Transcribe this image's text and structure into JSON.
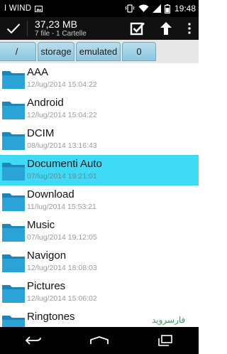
{
  "statusbar": {
    "carrier": "I WIND",
    "time": "19:48"
  },
  "actionbar": {
    "title": "37,23 MB",
    "subtitle": "7 file - 1 Cartelle"
  },
  "breadcrumb": [
    "/",
    "storage",
    "emulated",
    "0"
  ],
  "files": [
    {
      "name": "AAA",
      "date": "12/lug/2014 15:04:22",
      "selected": false
    },
    {
      "name": "Android",
      "date": "12/lug/2014 15:04:22",
      "selected": false
    },
    {
      "name": "DCIM",
      "date": "08/lug/2014 13:16:43",
      "selected": false
    },
    {
      "name": "Documenti Auto",
      "date": "07/lug/2014 19:21:01",
      "selected": true
    },
    {
      "name": "Download",
      "date": "11/lug/2014 15:53:21",
      "selected": false
    },
    {
      "name": "Music",
      "date": "07/lug/2014 19:12:05",
      "selected": false
    },
    {
      "name": "Navigon",
      "date": "12/lug/2014 18:08:03",
      "selected": false
    },
    {
      "name": "Pictures",
      "date": "12/lug/2014 15:06:02",
      "selected": false
    },
    {
      "name": "Ringtones",
      "date": "",
      "selected": false
    }
  ],
  "watermark": "فارسروید",
  "colors": {
    "selected": "#3fdaf5",
    "folder": "#1a86b9",
    "breadcrumb": "#a6d6ea"
  },
  "icons": {
    "actionbar": [
      "check-icon",
      "select-all-icon",
      "up-arrow-icon",
      "overflow-menu-icon"
    ],
    "navbar": [
      "back-icon",
      "home-icon",
      "recents-icon"
    ]
  }
}
